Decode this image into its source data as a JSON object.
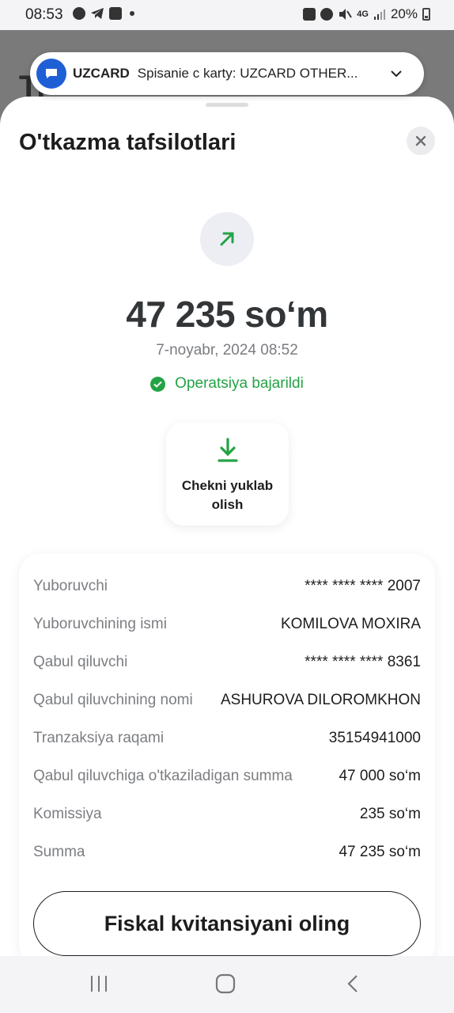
{
  "status_bar": {
    "time": "08:53",
    "battery": "20%",
    "network": "4G"
  },
  "background": {
    "ghost_text": "Tr"
  },
  "notification": {
    "app_name": "UZCARD",
    "message": "Spisanie c karty: UZCARD OTHER..."
  },
  "sheet": {
    "title": "O'tkazma tafsilotlari"
  },
  "transaction": {
    "amount": "47 235 so‘m",
    "datetime": "7-noyabr, 2024 08:52",
    "status": "Operatsiya bajarildi",
    "receipt_button": "Chekni yuklab olish"
  },
  "details": [
    {
      "key": "Yuboruvchi",
      "value": "**** **** **** 2007"
    },
    {
      "key": "Yuboruvchining ismi",
      "value": "KOMILOVA MOXIRA"
    },
    {
      "key": "Qabul qiluvchi",
      "value": "**** **** **** 8361"
    },
    {
      "key": "Qabul qiluvchining nomi",
      "value": "ASHUROVA DILOROMKHON"
    },
    {
      "key": "Tranzaksiya raqami",
      "value": "35154941000"
    },
    {
      "key": "Qabul qiluvchiga o'tkaziladigan summa",
      "value": "47 000 so‘m"
    },
    {
      "key": "Komissiya",
      "value": "235 so‘m"
    },
    {
      "key": "Summa",
      "value": "47 235 so‘m"
    }
  ],
  "fiscal_button": "Fiskal kvitansiyani oling",
  "colors": {
    "accent_green": "#23a345",
    "notif_icon_blue": "#1f5fd6"
  },
  "icons": [
    "chat-icon",
    "telegram-icon",
    "gallery-icon",
    "lock-icon",
    "alarm-icon",
    "mute-icon",
    "signal-icon",
    "battery-icon",
    "close-icon",
    "arrow-up-right-icon",
    "check-circle-icon",
    "download-icon",
    "chevron-down-icon",
    "recents-icon",
    "home-icon",
    "back-icon"
  ]
}
